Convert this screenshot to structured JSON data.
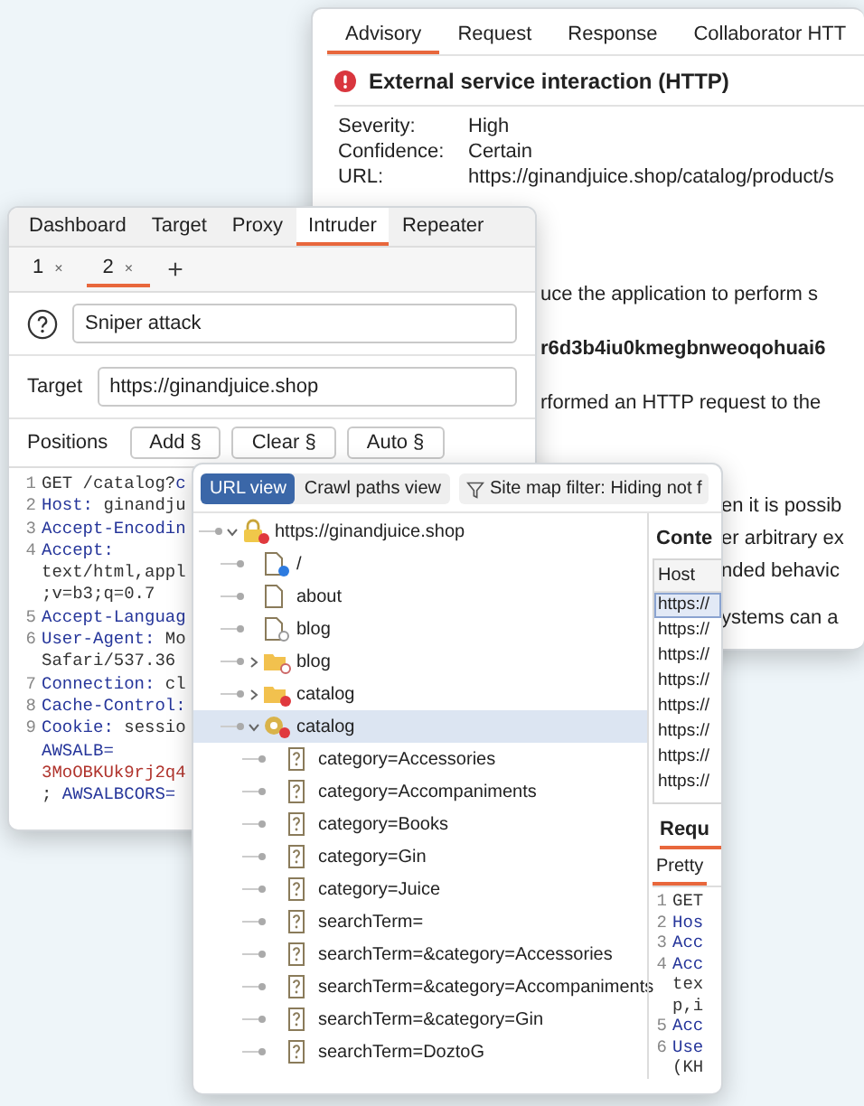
{
  "advisory_window": {
    "tabs": [
      {
        "label": "Advisory",
        "selected": true
      },
      {
        "label": "Request",
        "selected": false
      },
      {
        "label": "Response",
        "selected": false
      },
      {
        "label": "Collaborator HTT",
        "selected": false
      }
    ],
    "title": "External service interaction (HTTP)",
    "fields": [
      {
        "label": "Severity:",
        "value": "High"
      },
      {
        "label": "Confidence:",
        "value": "Certain"
      },
      {
        "label": "URL:",
        "value": "https://ginandjuice.shop/catalog/product/s"
      }
    ],
    "description_upper": [
      {
        "text": "uce the application to perform s",
        "kind": "plain"
      },
      {
        "text": "r6d3b4iu0kmegbnweoqohuai6",
        "kind": "bold"
      },
      {
        "text": "rformed an HTTP request to the",
        "kind": "plain"
      }
    ],
    "description_lower": [
      {
        "text": "en it is possib",
        "kind": "plain"
      },
      {
        "text": "er arbitrary ex",
        "kind": "plain"
      },
      {
        "text": "nded behavic",
        "kind": "plain"
      },
      {
        "text": "ystems can a",
        "kind": "paragraph"
      }
    ]
  },
  "intruder_window": {
    "tabs": [
      {
        "label": "Dashboard",
        "selected": false
      },
      {
        "label": "Target",
        "selected": false
      },
      {
        "label": "Proxy",
        "selected": false
      },
      {
        "label": "Intruder",
        "selected": true
      },
      {
        "label": "Repeater",
        "selected": false
      }
    ],
    "attack_tabs": [
      {
        "label": "1",
        "close": "×",
        "selected": false
      },
      {
        "label": "2",
        "close": "×",
        "selected": true
      }
    ],
    "add_tab": "+",
    "attack_type": "Sniper attack",
    "target_label": "Target",
    "target_value": "https://ginandjuice.shop",
    "positions_label": "Positions",
    "position_buttons": [
      "Add §",
      "Clear §",
      "Auto §"
    ],
    "request_lines": [
      {
        "number": "1",
        "segments": [
          {
            "text": "GET /catalog?",
            "kind": "plain"
          },
          {
            "text": "c",
            "kind": "key"
          }
        ]
      },
      {
        "number": "2",
        "segments": [
          {
            "text": "Host:",
            "kind": "key"
          },
          {
            "text": " ginandju",
            "kind": "plain"
          }
        ]
      },
      {
        "number": "3",
        "segments": [
          {
            "text": "Accept-Encodin",
            "kind": "key"
          }
        ]
      },
      {
        "number": "4",
        "segments": [
          {
            "text": "Accept:",
            "kind": "key"
          }
        ]
      },
      {
        "segments": [
          {
            "text": "text/html,appl",
            "kind": "plain"
          }
        ]
      },
      {
        "segments": [
          {
            "text": ";v=b3;q=0.7",
            "kind": "plain"
          }
        ]
      },
      {
        "number": "5",
        "segments": [
          {
            "text": "Accept-Languag",
            "kind": "key"
          }
        ]
      },
      {
        "number": "6",
        "segments": [
          {
            "text": "User-Agent:",
            "kind": "key"
          },
          {
            "text": " Mo",
            "kind": "plain"
          }
        ]
      },
      {
        "segments": [
          {
            "text": "Safari/537.36",
            "kind": "plain"
          }
        ]
      },
      {
        "number": "7",
        "segments": [
          {
            "text": "Connection:",
            "kind": "key"
          },
          {
            "text": " cl",
            "kind": "plain"
          }
        ]
      },
      {
        "number": "8",
        "segments": [
          {
            "text": "Cache-Control:",
            "kind": "key"
          }
        ]
      },
      {
        "number": "9",
        "segments": [
          {
            "text": "Cookie:",
            "kind": "key"
          },
          {
            "text": " sessio",
            "kind": "plain"
          }
        ]
      },
      {
        "segments": [
          {
            "text": "AWSALB=",
            "kind": "key"
          }
        ]
      },
      {
        "segments": [
          {
            "text": "3MoOBKUk9rj2q4",
            "kind": "value"
          }
        ]
      },
      {
        "segments": [
          {
            "text": "; ",
            "kind": "plain"
          },
          {
            "text": "AWSALBCORS=",
            "kind": "key"
          }
        ]
      }
    ]
  },
  "site_map_window": {
    "view_toggle": [
      {
        "label": "URL view",
        "selected": true
      },
      {
        "label": "Crawl paths view",
        "selected": false
      }
    ],
    "filter_label": "Site map filter: Hiding not f",
    "tree": [
      {
        "label": "https://ginandjuice.shop",
        "kind": "host",
        "expanded": true,
        "selected": false,
        "children": [
          {
            "label": "/",
            "kind": "page-new",
            "selected": false
          },
          {
            "label": "about",
            "kind": "page",
            "selected": false
          },
          {
            "label": "blog",
            "kind": "page-gray",
            "selected": false
          },
          {
            "label": "blog",
            "kind": "folder-gray",
            "expanded": false,
            "selected": false
          },
          {
            "label": "catalog",
            "kind": "folder-red",
            "expanded": false,
            "selected": false
          },
          {
            "label": "catalog",
            "kind": "gear-red",
            "expanded": true,
            "selected": true,
            "children": [
              {
                "label": "category=Accessories",
                "kind": "param",
                "selected": false
              },
              {
                "label": "category=Accompaniments",
                "kind": "param",
                "selected": false
              },
              {
                "label": "category=Books",
                "kind": "param",
                "selected": false
              },
              {
                "label": "category=Gin",
                "kind": "param",
                "selected": false
              },
              {
                "label": "category=Juice",
                "kind": "param",
                "selected": false
              },
              {
                "label": "searchTerm=",
                "kind": "param",
                "selected": false
              },
              {
                "label": "searchTerm=&category=Accessories",
                "kind": "param",
                "selected": false
              },
              {
                "label": "searchTerm=&category=Accompaniments",
                "kind": "param",
                "selected": false
              },
              {
                "label": "searchTerm=&category=Gin",
                "kind": "param",
                "selected": false
              },
              {
                "label": "searchTerm=DoztoG",
                "kind": "param",
                "selected": false
              }
            ]
          }
        ]
      }
    ],
    "contents_heading": "Conte",
    "hosts_column": "Host",
    "host_rows": [
      {
        "text": "https://",
        "selected": true
      },
      {
        "text": "https://",
        "selected": false
      },
      {
        "text": "https://",
        "selected": false
      },
      {
        "text": "https://",
        "selected": false
      },
      {
        "text": "https://",
        "selected": false
      },
      {
        "text": "https://",
        "selected": false
      },
      {
        "text": "https://",
        "selected": false
      },
      {
        "text": "https://",
        "selected": false
      }
    ],
    "request_heading": "Requ",
    "request_tabs": [
      {
        "label": "Pretty",
        "selected": true
      }
    ],
    "request_lines": [
      {
        "number": "1",
        "segments": [
          {
            "text": "GET",
            "kind": "plain"
          }
        ]
      },
      {
        "number": "2",
        "segments": [
          {
            "text": "Hos",
            "kind": "key"
          }
        ]
      },
      {
        "number": "3",
        "segments": [
          {
            "text": "Acc",
            "kind": "key"
          }
        ]
      },
      {
        "number": "4",
        "segments": [
          {
            "text": "Acc",
            "kind": "key"
          }
        ]
      },
      {
        "segments": [
          {
            "text": "tex",
            "kind": "plain"
          }
        ]
      },
      {
        "segments": [
          {
            "text": "p,i",
            "kind": "plain"
          }
        ]
      },
      {
        "number": "5",
        "segments": [
          {
            "text": "Acc",
            "kind": "key"
          }
        ]
      },
      {
        "number": "6",
        "segments": [
          {
            "text": "Use",
            "kind": "key"
          }
        ]
      },
      {
        "segments": [
          {
            "text": "(KH",
            "kind": "plain"
          }
        ]
      }
    ]
  }
}
